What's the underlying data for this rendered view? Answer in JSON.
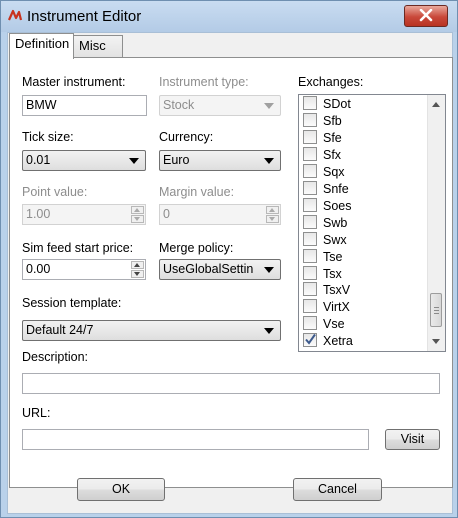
{
  "window": {
    "title": "Instrument Editor"
  },
  "tabs": [
    {
      "label": "Definition"
    },
    {
      "label": "Misc"
    }
  ],
  "form": {
    "master_instrument": {
      "label": "Master instrument:",
      "value": "BMW"
    },
    "instrument_type": {
      "label": "Instrument type:",
      "value": "Stock"
    },
    "tick_size": {
      "label": "Tick size:",
      "value": "0.01"
    },
    "currency": {
      "label": "Currency:",
      "value": "Euro"
    },
    "point_value": {
      "label": "Point value:",
      "value": "1.00"
    },
    "margin_value": {
      "label": "Margin value:",
      "value": "0"
    },
    "sim_feed_start_price": {
      "label": "Sim feed start price:",
      "value": "0.00"
    },
    "merge_policy": {
      "label": "Merge policy:",
      "value": "UseGlobalSettin"
    },
    "session_template": {
      "label": "Session template:",
      "value": "Default 24/7"
    },
    "description": {
      "label": "Description:",
      "value": ""
    },
    "url": {
      "label": "URL:",
      "value": ""
    },
    "visit_label": "Visit"
  },
  "exchanges": {
    "label": "Exchanges:",
    "items": [
      {
        "name": "SDot",
        "checked": false
      },
      {
        "name": "Sfb",
        "checked": false
      },
      {
        "name": "Sfe",
        "checked": false
      },
      {
        "name": "Sfx",
        "checked": false
      },
      {
        "name": "Sqx",
        "checked": false
      },
      {
        "name": "Snfe",
        "checked": false
      },
      {
        "name": "Soes",
        "checked": false
      },
      {
        "name": "Swb",
        "checked": false
      },
      {
        "name": "Swx",
        "checked": false
      },
      {
        "name": "Tse",
        "checked": false
      },
      {
        "name": "Tsx",
        "checked": false
      },
      {
        "name": "TsxV",
        "checked": false
      },
      {
        "name": "VirtX",
        "checked": false
      },
      {
        "name": "Vse",
        "checked": false
      },
      {
        "name": "Xetra",
        "checked": true
      }
    ]
  },
  "footer": {
    "ok_label": "OK",
    "cancel_label": "Cancel"
  },
  "colors": {
    "title_bar": "#b9d1ea",
    "close_button": "#c9483a",
    "accent_check": "#3d5a8c"
  },
  "icons": {
    "app": "ninjatrader-logo-icon",
    "close": "close-icon"
  }
}
